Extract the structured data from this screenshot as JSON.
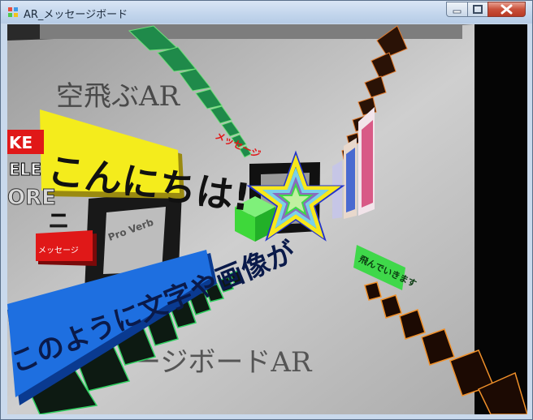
{
  "window": {
    "title": "AR_メッセージボード"
  },
  "scene": {
    "printed_top": "空飛ぶAR",
    "printed_bottom": "ージボードAR",
    "marker_text": "Pro Verb",
    "banner_yellow": "こんにちは!",
    "banner_blue": "このように文字や画像が",
    "banner_red": "メッセージ",
    "banner_green": "飛んでいきます",
    "side_white": "ELE",
    "side_red_small": "KE",
    "side_white_2": "ORE",
    "side_small": "二",
    "colors": {
      "yellow": "#f4ec1c",
      "blue": "#1e6fe0",
      "red": "#e01818",
      "green": "#3fd84a",
      "star_outer": "#f7e81c",
      "star_inner": "#7ad0e8"
    }
  }
}
